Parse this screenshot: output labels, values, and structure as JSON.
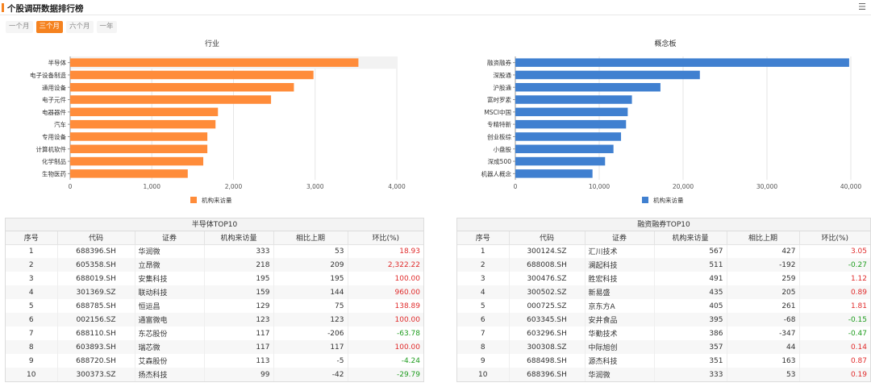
{
  "header": {
    "title": "个股调研数据排行榜",
    "menu_icon": "menu-icon"
  },
  "tabs": [
    {
      "label": "一个月",
      "active": false
    },
    {
      "label": "三个月",
      "active": true
    },
    {
      "label": "六个月",
      "active": false
    },
    {
      "label": "一年",
      "active": false
    }
  ],
  "colors": {
    "accent": "#f5821f",
    "industry_bar": "#ff8c3a",
    "concept_bar": "#4080d0",
    "positive": "#e02b2b",
    "negative": "#1e9c1e"
  },
  "chart_data": [
    {
      "type": "bar",
      "orientation": "horizontal",
      "title": "行业",
      "categories": [
        "半导体",
        "电子设备制造",
        "通用设备",
        "电子元件",
        "电器器件",
        "汽车",
        "专用设备",
        "计算机软件",
        "化学制品",
        "生物医药"
      ],
      "series": [
        {
          "name": "机构来访量",
          "values": [
            3530,
            2980,
            2740,
            2460,
            1810,
            1780,
            1680,
            1680,
            1630,
            1440
          ]
        }
      ],
      "xlim": [
        0,
        4000
      ],
      "ticks": [
        "0",
        "1,000",
        "2,000",
        "3,000",
        "4,000"
      ],
      "legend": "bottom",
      "grid": true,
      "highlight_row": 0
    },
    {
      "type": "bar",
      "orientation": "horizontal",
      "title": "概念板",
      "categories": [
        "融资融券",
        "深股通",
        "沪股通",
        "富时罗素",
        "MSCI中国",
        "专精特新",
        "创业板综",
        "小盘股",
        "深成500",
        "机器人概念"
      ],
      "series": [
        {
          "name": "机构来访量",
          "values": [
            39800,
            22000,
            17300,
            13900,
            13400,
            13200,
            12600,
            11700,
            10700,
            9200
          ]
        }
      ],
      "xlim": [
        0,
        40000
      ],
      "ticks": [
        "0",
        "10,000",
        "20,000",
        "30,000",
        "40,000"
      ],
      "legend": "bottom",
      "grid": true
    }
  ],
  "tables": [
    {
      "title": "半导体TOP10",
      "headers": [
        "序号",
        "代码",
        "证券",
        "机构来访量",
        "相比上期",
        "环比(%)"
      ],
      "rows": [
        [
          "1",
          "688396.SH",
          "华润微",
          "333",
          "53",
          "18.93"
        ],
        [
          "2",
          "605358.SH",
          "立昂微",
          "218",
          "209",
          "2,322.22"
        ],
        [
          "3",
          "688019.SH",
          "安集科技",
          "195",
          "195",
          "100.00"
        ],
        [
          "4",
          "301369.SZ",
          "联动科技",
          "159",
          "144",
          "960.00"
        ],
        [
          "5",
          "688785.SH",
          "恒运昌",
          "129",
          "75",
          "138.89"
        ],
        [
          "6",
          "002156.SZ",
          "通富微电",
          "123",
          "123",
          "100.00"
        ],
        [
          "7",
          "688110.SH",
          "东芯股份",
          "117",
          "-206",
          "-63.78"
        ],
        [
          "8",
          "603893.SH",
          "瑞芯微",
          "117",
          "117",
          "100.00"
        ],
        [
          "9",
          "688720.SH",
          "艾森股份",
          "113",
          "-5",
          "-4.24"
        ],
        [
          "10",
          "300373.SZ",
          "扬杰科技",
          "99",
          "-42",
          "-29.79"
        ]
      ]
    },
    {
      "title": "融资融券TOP10",
      "headers": [
        "序号",
        "代码",
        "证券",
        "机构来访量",
        "相比上期",
        "环比(%)"
      ],
      "rows": [
        [
          "1",
          "300124.SZ",
          "汇川技术",
          "567",
          "427",
          "3.05"
        ],
        [
          "2",
          "688008.SH",
          "澜起科技",
          "511",
          "-192",
          "-0.27"
        ],
        [
          "3",
          "300476.SZ",
          "胜宏科技",
          "491",
          "259",
          "1.12"
        ],
        [
          "4",
          "300502.SZ",
          "新易盛",
          "435",
          "205",
          "0.89"
        ],
        [
          "5",
          "000725.SZ",
          "京东方A",
          "405",
          "261",
          "1.81"
        ],
        [
          "6",
          "603345.SH",
          "安井食品",
          "395",
          "-68",
          "-0.15"
        ],
        [
          "7",
          "603296.SH",
          "华勤技术",
          "386",
          "-347",
          "-0.47"
        ],
        [
          "8",
          "300308.SZ",
          "中际旭创",
          "357",
          "44",
          "0.14"
        ],
        [
          "9",
          "688498.SH",
          "源杰科技",
          "351",
          "163",
          "0.87"
        ],
        [
          "10",
          "688396.SH",
          "华润微",
          "333",
          "53",
          "0.19"
        ]
      ]
    }
  ]
}
